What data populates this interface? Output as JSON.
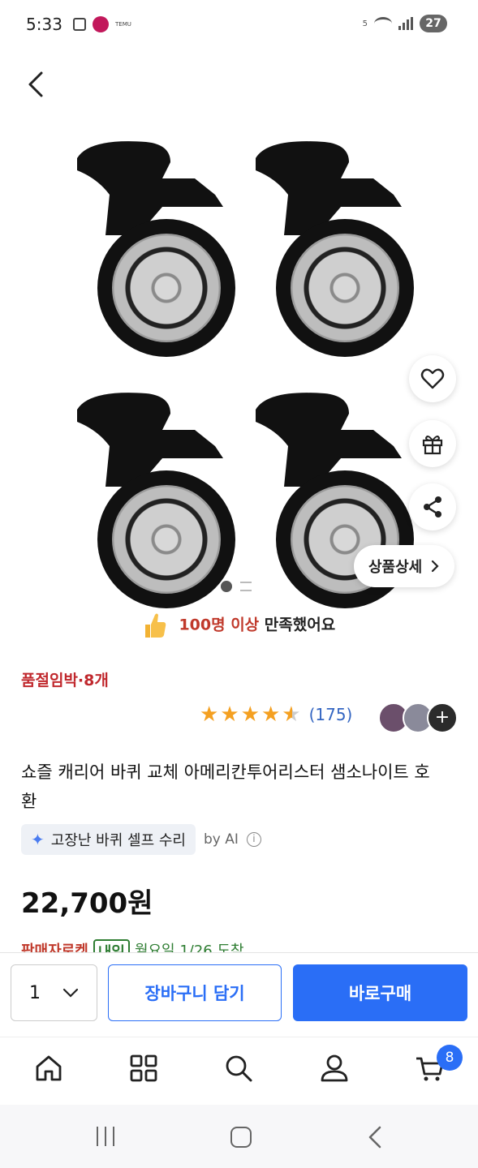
{
  "status_bar": {
    "time": "5:33",
    "app_label": "TEMU",
    "battery": "27",
    "network": "5"
  },
  "product": {
    "satisfaction": {
      "highlight": "100명 이상",
      "rest": "만족했어요"
    },
    "stock_warning": "품절임박·8개",
    "rating": 4.5,
    "review_count": "(175)",
    "title": "쇼즐 캐리어 바퀴 교체 아메리칸투어리스터 샘소나이트 호환",
    "ai_summary_label": "고장난 바퀴 셀프 수리",
    "by_ai": "by AI",
    "price": "22,700원",
    "delivery_label": "판매자로켓",
    "delivery_badge": "내일",
    "delivery_date": "월요일 1/26 도착",
    "detail_button": "상품상세"
  },
  "purchase_bar": {
    "quantity": "1",
    "add_to_cart": "장바구니 담기",
    "buy_now": "바로구매"
  },
  "bottom_nav": {
    "cart_badge": "8"
  },
  "colors": {
    "accent": "#2a6ef6",
    "warning": "#c0282d",
    "star": "#f4a021",
    "delivery_green": "#2e7d32"
  }
}
